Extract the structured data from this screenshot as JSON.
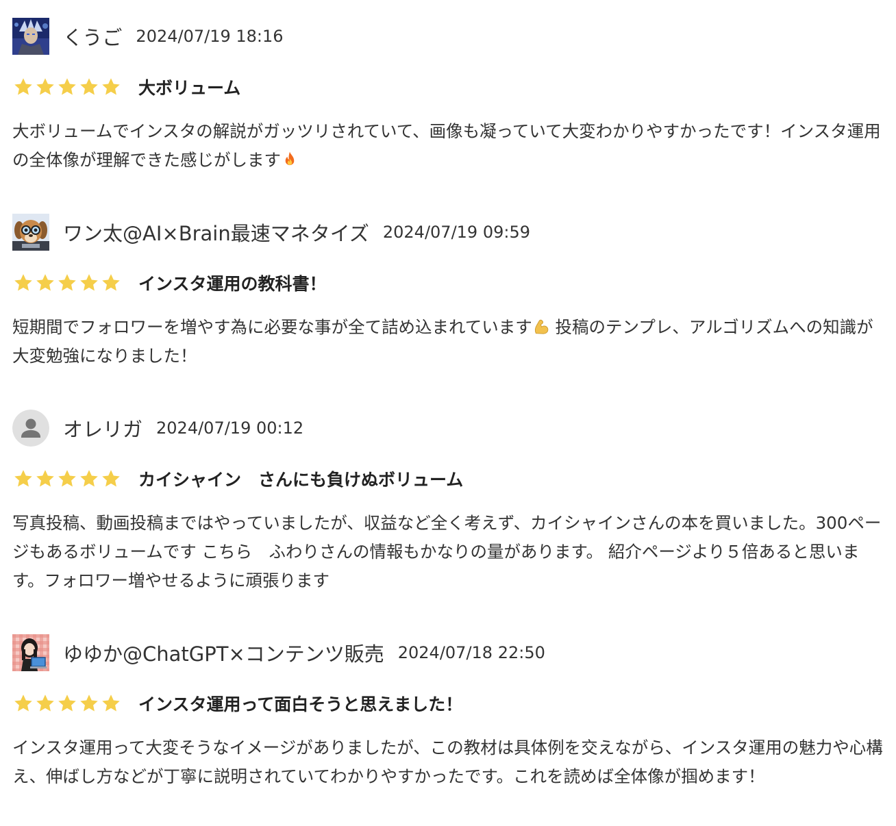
{
  "colors": {
    "star": "#F5CE4A",
    "text": "#333333"
  },
  "reviews": [
    {
      "avatar_icon": "anime-warrior-avatar",
      "user_name": "くうご",
      "date": "2024/07/19 18:16",
      "rating": 5,
      "title": "大ボリューム",
      "body_before_emoji": "大ボリュームでインスタの解説がガッツリされていて、画像も凝っていて大変わかりやすかったです！インスタ運用の全体像が理解できた感じがします",
      "emoji_icon": "fire-icon",
      "body_after_emoji": ""
    },
    {
      "avatar_icon": "dog-with-glasses-avatar",
      "user_name": "ワン太@AI×Brain最速マネタイズ",
      "date": "2024/07/19 09:59",
      "rating": 5,
      "title": "インスタ運用の教科書！",
      "body_before_emoji": "短期間でフォロワーを増やす為に必要な事が全て詰め込まれています",
      "emoji_icon": "flexed-biceps-icon",
      "body_after_emoji": " 投稿のテンプレ、アルゴリズムへの知識が大変勉強になりました！"
    },
    {
      "avatar_icon": "default-user-avatar",
      "user_name": "オレリガ",
      "date": "2024/07/19 00:12",
      "rating": 5,
      "title": "カイシャイン　さんにも負けぬボリューム",
      "body_before_emoji": "写真投稿、動画投稿まではやっていましたが、収益など全く考えず、カイシャインさんの本を買いました。300ページもあるボリュームです こちら　ふわりさんの情報もかなりの量があります。 紹介ページより５倍あると思います。フォロワー増やせるように頑張ります",
      "emoji_icon": "",
      "body_after_emoji": ""
    },
    {
      "avatar_icon": "woman-with-laptop-avatar",
      "user_name": "ゆゆか@ChatGPT×コンテンツ販売",
      "date": "2024/07/18 22:50",
      "rating": 5,
      "title": "インスタ運用って面白そうと思えました！",
      "body_before_emoji": "インスタ運用って大変そうなイメージがありましたが、この教材は具体例を交えながら、インスタ運用の魅力や心構え、伸ばし方などが丁寧に説明されていてわかりやすかったです。これを読めば全体像が掴めます！",
      "emoji_icon": "",
      "body_after_emoji": ""
    }
  ]
}
